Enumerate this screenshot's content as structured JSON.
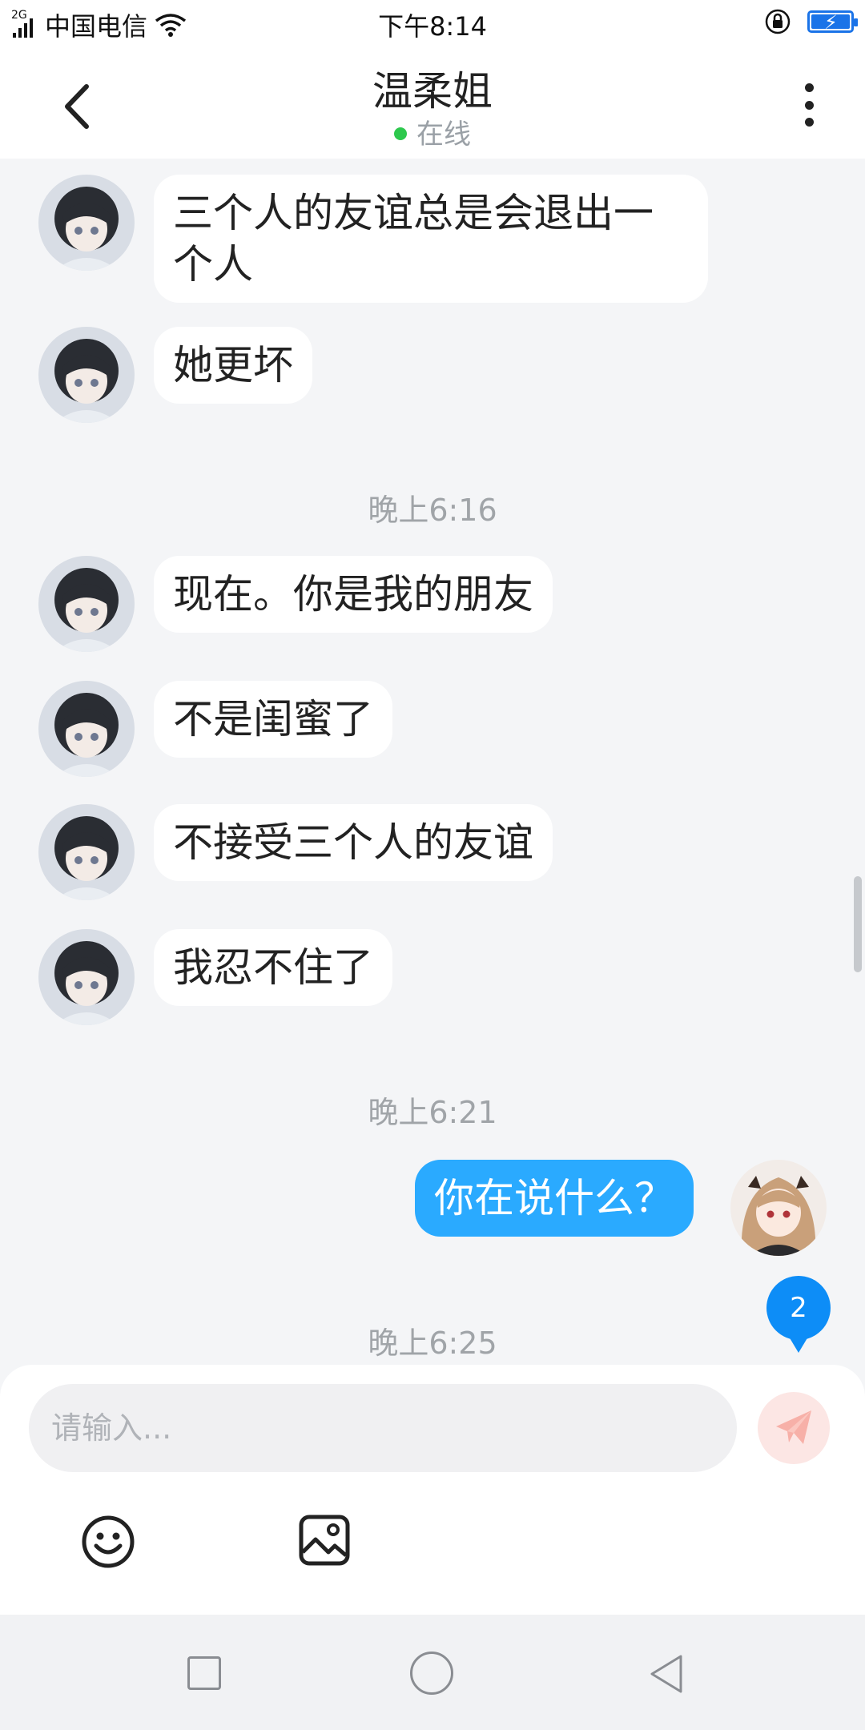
{
  "status_bar": {
    "network_type": "2G",
    "carrier": "中国电信",
    "time": "下午8:14",
    "battery_level_fraction": 0.95,
    "icons": [
      "signal-icon",
      "wifi-icon",
      "rotation-lock-icon",
      "battery-charging-icon"
    ]
  },
  "header": {
    "title": "温柔姐",
    "status": "在线",
    "status_color": "#2dc84d",
    "icons": [
      "back-chevron-icon",
      "more-vertical-icon"
    ]
  },
  "messages": {
    "m1": {
      "text_line1": "三个人的友谊总是会退出一",
      "text_line2": "个人",
      "sender": "other"
    },
    "m2": {
      "text": "她更坏",
      "sender": "other"
    },
    "time1": "晚上6:16",
    "m3": {
      "text": "现在。你是我的朋友",
      "sender": "other"
    },
    "m4": {
      "text": "不是闺蜜了",
      "sender": "other"
    },
    "m5": {
      "text": "不接受三个人的友谊",
      "sender": "other"
    },
    "m6": {
      "text": "我忍不住了",
      "sender": "other"
    },
    "time2": "晚上6:21",
    "m7": {
      "text": "你在说什么？",
      "sender": "me"
    },
    "time3": "晚上6:25"
  },
  "unread_badge": "2",
  "composer": {
    "placeholder": "请输入...",
    "icons": [
      "send-plane-icon",
      "emoji-smile-icon",
      "image-icon"
    ]
  },
  "colors": {
    "accent": "#2aaaff",
    "badge": "#0d8df7",
    "chat_bg": "#f4f5f7"
  }
}
